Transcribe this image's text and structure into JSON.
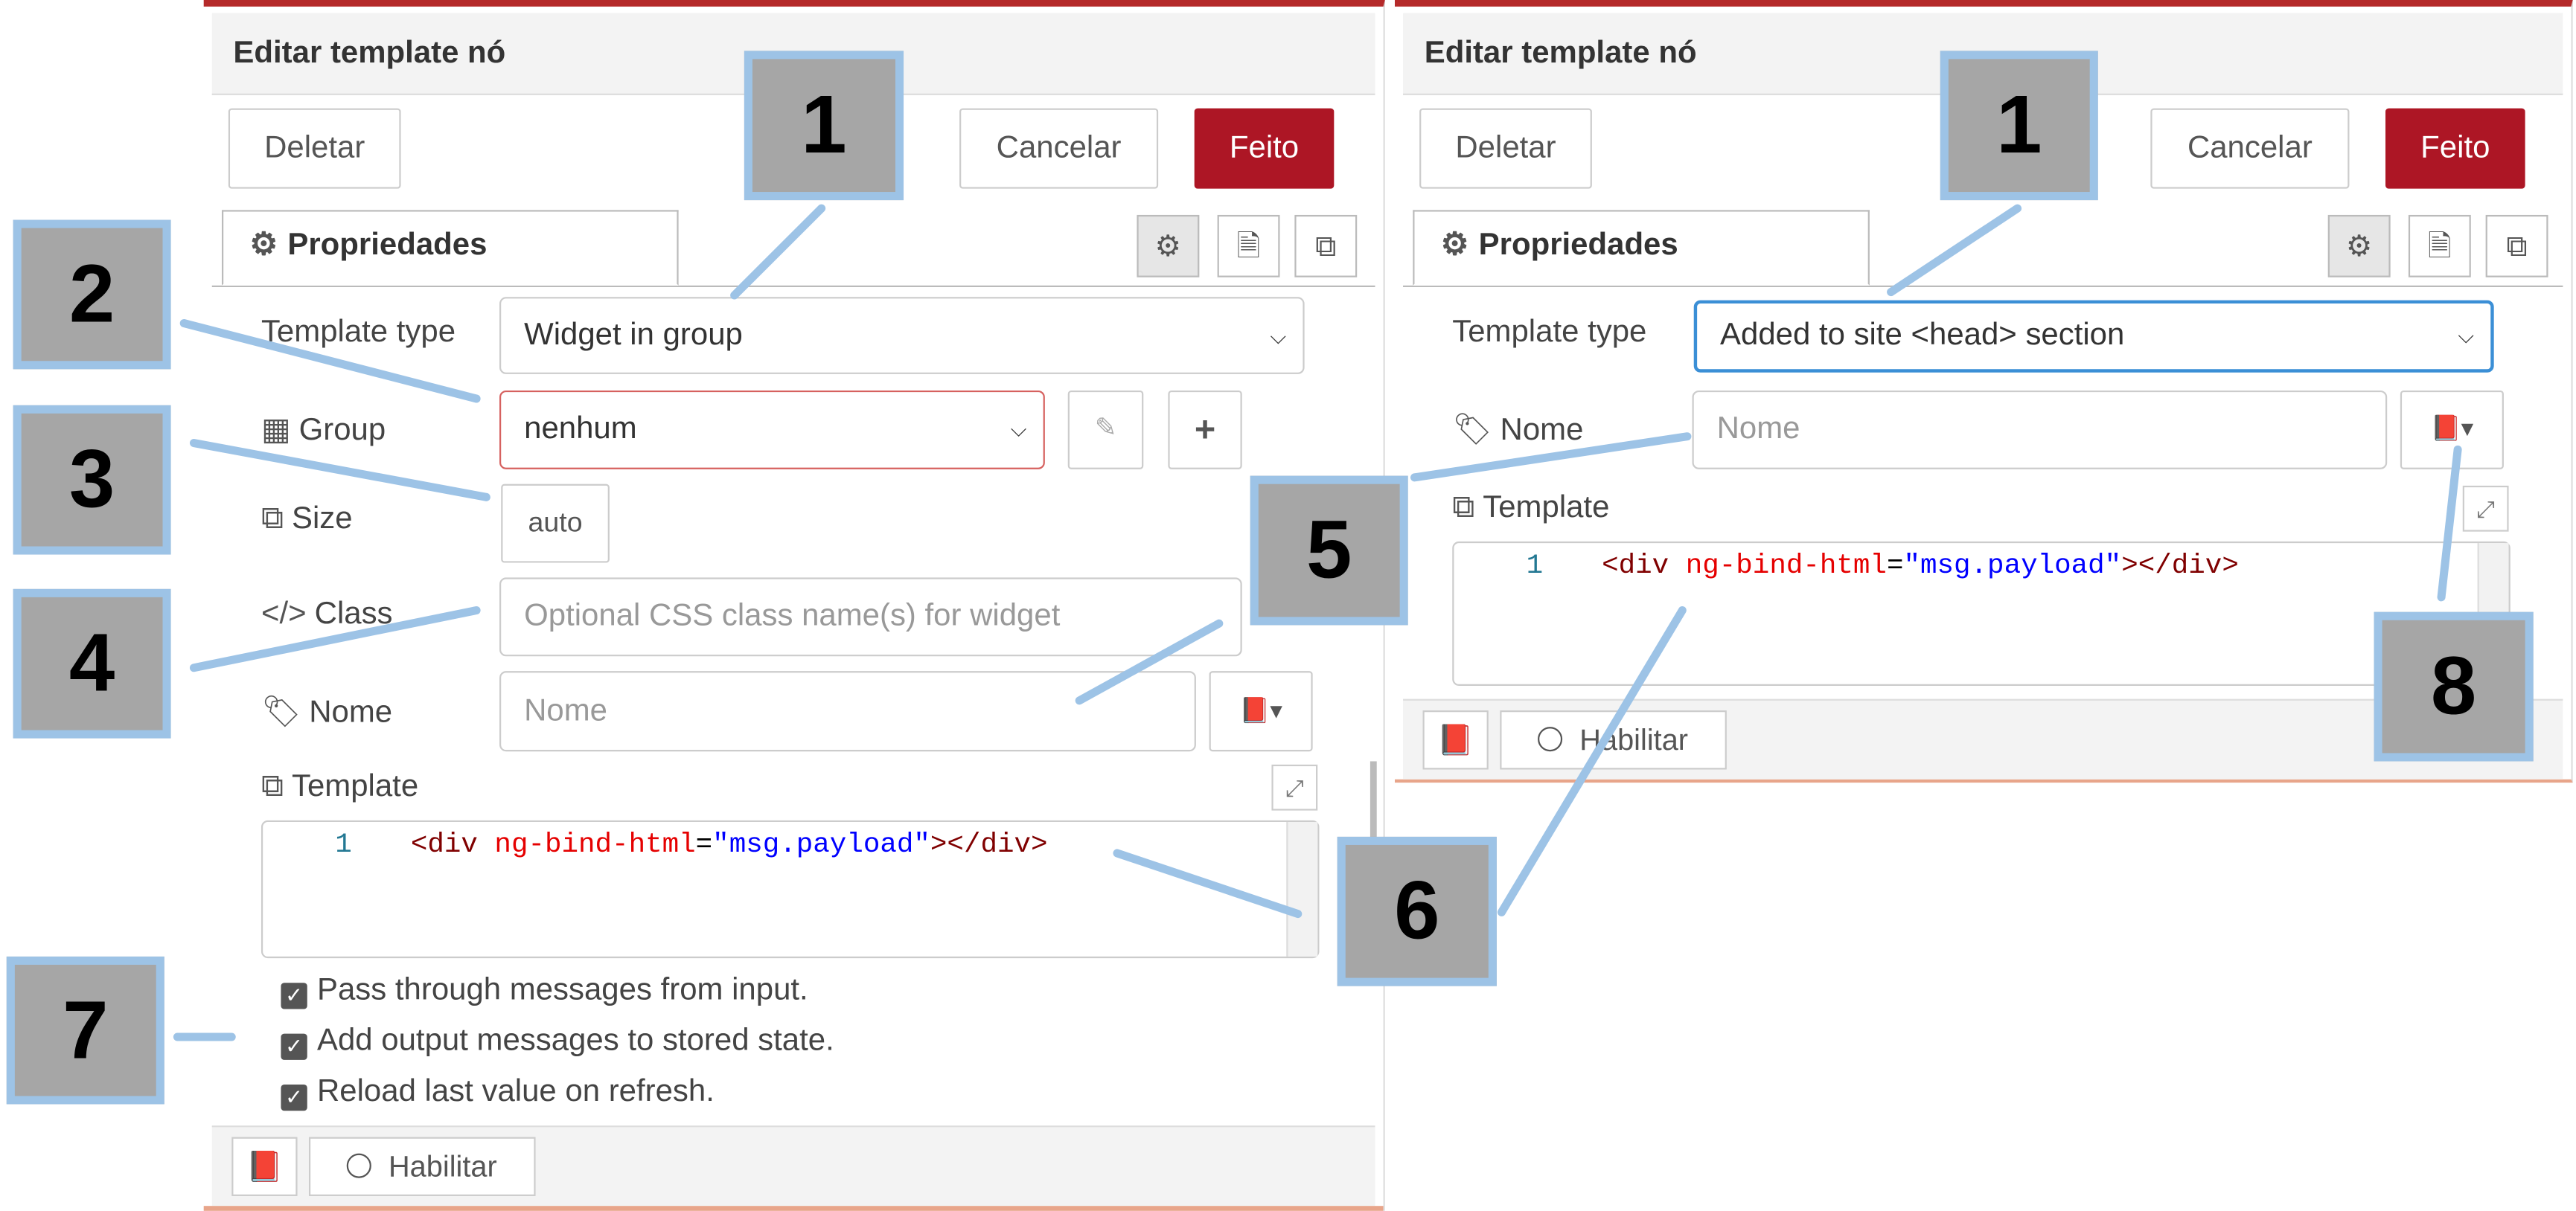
{
  "left": {
    "title": "Editar template nó",
    "delete_label": "Deletar",
    "cancel_label": "Cancelar",
    "done_label": "Feito",
    "tab_label": "Propriedades",
    "template_type_label": "Template type",
    "template_type_value": "Widget in group",
    "group_label": "Group",
    "group_value": "nenhum",
    "size_label": "Size",
    "size_value": "auto",
    "class_label": "Class",
    "class_placeholder": "Optional CSS class name(s) for widget",
    "name_label": "Nome",
    "name_placeholder": "Nome",
    "template_label": "Template",
    "code_line_no": "1",
    "code": {
      "open": "<div ",
      "attr": "ng-bind-html",
      "eq": "=",
      "str": "\"msg.payload\"",
      "close": "></div>"
    },
    "checks": [
      "Pass through messages from input.",
      "Add output messages to stored state.",
      "Reload last value on refresh."
    ],
    "enable_label": "Habilitar"
  },
  "right": {
    "title": "Editar template nó",
    "delete_label": "Deletar",
    "cancel_label": "Cancelar",
    "done_label": "Feito",
    "tab_label": "Propriedades",
    "template_type_label": "Template type",
    "template_type_value": "Added to site <head> section",
    "name_label": "Nome",
    "name_placeholder": "Nome",
    "template_label": "Template",
    "code_line_no": "1",
    "code": {
      "open": "<div ",
      "attr": "ng-bind-html",
      "eq": "=",
      "str": "\"msg.payload\"",
      "close": "></div>"
    },
    "enable_label": "Habilitar"
  },
  "callouts": [
    "1",
    "2",
    "3",
    "4",
    "5",
    "6",
    "7",
    "1",
    "8"
  ],
  "icons": [
    "gear-icon",
    "document-icon",
    "frame-icon",
    "table-icon",
    "size-icon",
    "code-icon",
    "tag-icon",
    "book-icon",
    "copy-icon",
    "pencil-icon",
    "plus-icon",
    "expand-icon"
  ],
  "colors": {
    "done": "#ad1625",
    "callout_fill": "#a6a6a6",
    "callout_border": "#9dc3e6",
    "leader_line": "#9dc3e6",
    "top_accent": "#b52a2a"
  }
}
